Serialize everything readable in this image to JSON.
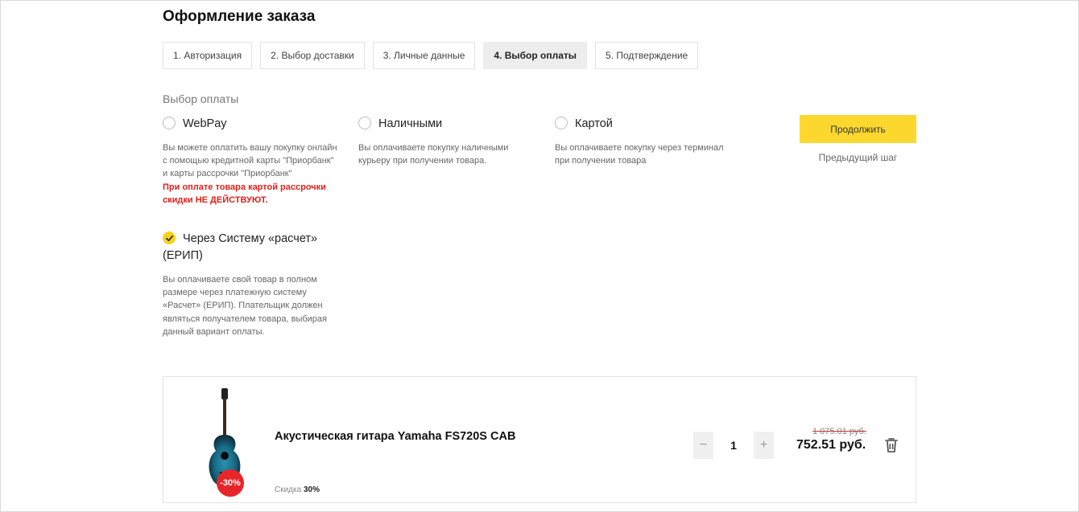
{
  "page": {
    "title": "Оформление заказа"
  },
  "steps": [
    {
      "label": "1. Авторизация",
      "active": false
    },
    {
      "label": "2. Выбор доставки",
      "active": false
    },
    {
      "label": "3. Личные данные",
      "active": false
    },
    {
      "label": "4. Выбор оплаты",
      "active": true
    },
    {
      "label": "5. Подтверждение",
      "active": false
    }
  ],
  "payment": {
    "section_label": "Выбор оплаты",
    "options": [
      {
        "title": "WebPay",
        "desc_lines": [
          "Вы можете оплатить вашу покупку онлайн",
          "с помощью кредитной карты \"Приорбанк\"",
          "и карты рассрочки \"Приорбанк\""
        ],
        "warning_lines": [
          "При оплате товара картой рассрочки",
          "скидки НЕ ДЕЙСТВУЮТ."
        ],
        "selected": false
      },
      {
        "title": "Наличными",
        "desc_lines": [
          "Вы оплачиваете покупку наличными",
          "курьеру при получении товара."
        ],
        "selected": false
      },
      {
        "title": "Картой",
        "desc_lines": [
          "Вы оплачиваете покупку через терминал",
          "при получении товара"
        ],
        "selected": false
      },
      {
        "title_lines": [
          "Через Систему «расчет»",
          "(ЕРИП)"
        ],
        "desc_lines": [
          "Вы оплачиваете свой товар в полном",
          "размере через платежную систему",
          "«Расчет» (ЕРИП). Плательщик должен",
          "являться получателем товара, выбирая",
          "данный вариант оплаты."
        ],
        "selected": true
      }
    ]
  },
  "actions": {
    "continue_label": "Продолжить",
    "prev_label": "Предыдущий шаг"
  },
  "cart": {
    "item": {
      "name": "Акустическая гитара Yamaha FS720S CAB",
      "badge": "-30%",
      "discount_label": "Скидка",
      "discount_value": "30%",
      "quantity": "1",
      "minus": "−",
      "plus": "+",
      "old_price": "1 075.01 руб.",
      "price": "752.51 руб."
    }
  },
  "colors": {
    "accent": "#fcd82e",
    "warning": "#e0201b",
    "badge": "#e8262a"
  },
  "icons": {
    "check": "check-icon",
    "trash": "trash-icon",
    "guitar": "guitar-image"
  }
}
